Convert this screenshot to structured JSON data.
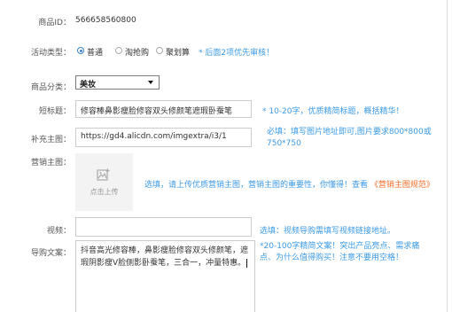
{
  "product_id": {
    "label": "商品ID：",
    "value": "566658560800"
  },
  "activity_type": {
    "label": "活动类型：",
    "options": [
      "普通",
      "淘抢购",
      "聚划算"
    ],
    "selected": "普通",
    "hint": "* 后面2项优先审核！"
  },
  "category": {
    "label": "商品分类：",
    "value": "美妆"
  },
  "short_title": {
    "label": "短标题：",
    "value": "修容棒鼻影瘦脸修容双头修颜笔遮瑕卧蚕笔",
    "hint": "* 10-20字，优质精简标题，概括精华！"
  },
  "extra_image": {
    "label": "补充主图：",
    "value": "https://gd4.alicdn.com/imgextra/i3/1",
    "hint": "必填：填写图片地址即可,图片要求800*800或750*750"
  },
  "marketing_image": {
    "label": "营销主图：",
    "upload_label": "点击上传",
    "hint_prefix": "选填，请上传优质营销主图，营销主图的重要性，你懂得！查看",
    "hint_link": "《营销主图规范》"
  },
  "video": {
    "label": "视频：",
    "value": "",
    "hint": "选填：视频导购需填写视频链接地址。"
  },
  "guide_copy": {
    "label": "导购文案：",
    "value": "抖音高光修容棒，鼻影瘦脸修容双头修颜笔，遮瑕阴影瘦V脸侧影卧蚕笔，三合一，冲量特惠。",
    "hint": "*20-100字精简文案！突出产品亮点、需求痛点、为什么值得购买！注意不要用空格！"
  },
  "colors": {
    "hint_blue": "#3b9ae6",
    "hint_orange": "#f06d2a",
    "radio_accent": "#3b82c4"
  }
}
